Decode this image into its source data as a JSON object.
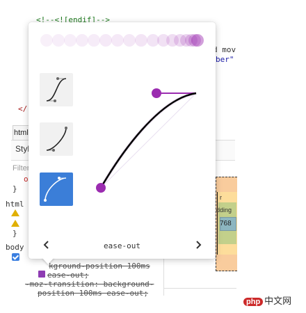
{
  "code": {
    "comment_line": "<!--<![endif]-->",
    "frag_move": "d mov",
    "frag_ber": "ber\"",
    "frag_slash": "</"
  },
  "devtools": {
    "tab_html": "html",
    "styles_label": "Styl",
    "filter_placeholder": "Filter",
    "lines": {
      "o_line": "o",
      "brace1": "}",
      "html_sel": "html",
      "brace2": "}",
      "body_sel": "body",
      "prop1": "-webkit-transition: background-position 100ms",
      "prop1_visible": "kground-position 100ms",
      "ease_out": "ease-out;",
      "prop2": "-moz-transition: background-",
      "prop3": "position 100ms ease-out;"
    },
    "box_model": {
      "border_label": "r",
      "padding_label": "dding",
      "content_width": "768"
    }
  },
  "bezier_editor": {
    "current_easing": "ease-out",
    "prev_label": "previous-preset",
    "next_label": "next-preset",
    "accent_color": "#9b2cb0",
    "selected_preset_color": "#3b7ed8",
    "control_point_1": [
      0.0,
      0.0
    ],
    "control_point_2": [
      0.58,
      1.0
    ]
  },
  "watermark": {
    "logo": "php",
    "text": "中文网"
  }
}
